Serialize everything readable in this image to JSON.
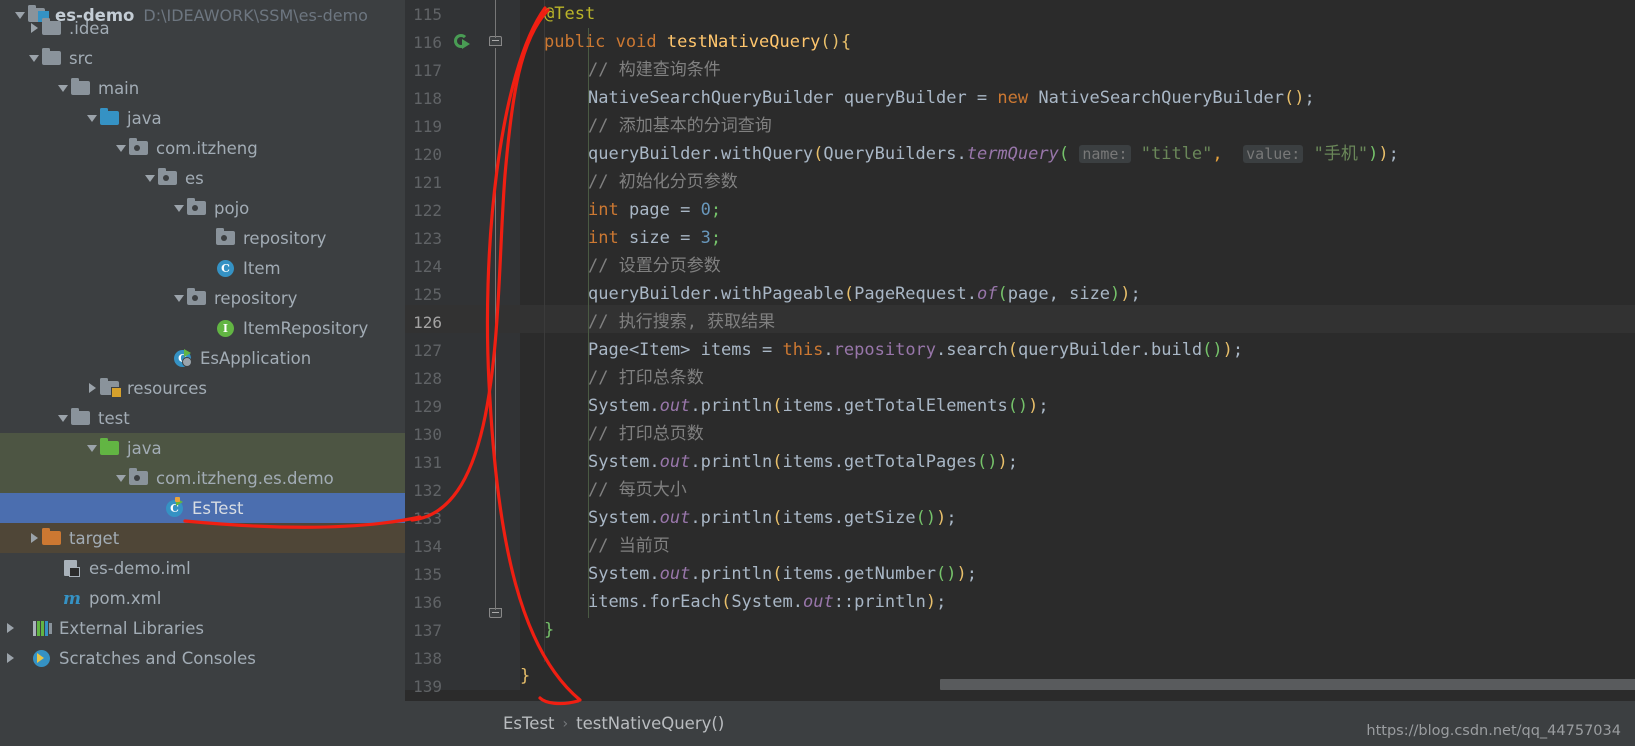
{
  "sidebar": {
    "project_root": {
      "name": "es-demo",
      "path": "D:\\IDEAWORK\\SSM\\es-demo"
    },
    "items": [
      {
        "label": ".idea",
        "indent": 1,
        "arrow": "right",
        "icon": "folder-gray-icon"
      },
      {
        "label": "src",
        "indent": 1,
        "arrow": "down",
        "icon": "folder-gray-icon"
      },
      {
        "label": "main",
        "indent": 2,
        "arrow": "down",
        "icon": "folder-gray-icon"
      },
      {
        "label": "java",
        "indent": 3,
        "arrow": "down",
        "icon": "folder-blue-source-icon"
      },
      {
        "label": "com.itzheng",
        "indent": 4,
        "arrow": "down",
        "icon": "package-icon"
      },
      {
        "label": "es",
        "indent": 5,
        "arrow": "down",
        "icon": "package-icon"
      },
      {
        "label": "pojo",
        "indent": 6,
        "arrow": "down",
        "icon": "package-icon"
      },
      {
        "label": "repository",
        "indent": 7,
        "arrow": "none",
        "icon": "package-icon"
      },
      {
        "label": "Item",
        "indent": 7,
        "arrow": "none",
        "icon": "java-class-icon"
      },
      {
        "label": "repository",
        "indent": 6,
        "arrow": "down",
        "icon": "package-icon"
      },
      {
        "label": "ItemRepository",
        "indent": 7,
        "arrow": "none",
        "icon": "java-interface-icon"
      },
      {
        "label": "EsApplication",
        "indent": 6,
        "arrow": "none",
        "icon": "spring-boot-class-icon"
      },
      {
        "label": "resources",
        "indent": 3,
        "arrow": "right",
        "icon": "folder-resources-icon"
      },
      {
        "label": "test",
        "indent": 2,
        "arrow": "down",
        "icon": "folder-gray-icon"
      },
      {
        "label": "java",
        "indent": 3,
        "arrow": "down",
        "icon": "folder-green-test-source-icon"
      },
      {
        "label": "com.itzheng.es.demo",
        "indent": 4,
        "arrow": "down",
        "icon": "package-icon"
      },
      {
        "label": "EsTest",
        "indent": 5,
        "arrow": "none",
        "icon": "java-test-class-icon"
      },
      {
        "label": "target",
        "indent": 1,
        "arrow": "right",
        "icon": "folder-orange-excluded-icon"
      },
      {
        "label": "es-demo.iml",
        "indent": 2,
        "arrow": "none",
        "icon": "iml-module-file-icon"
      },
      {
        "label": "pom.xml",
        "indent": 2,
        "arrow": "none",
        "icon": "maven-pom-icon"
      },
      {
        "label": "External Libraries",
        "indent": 0,
        "arrow": "right",
        "icon": "libraries-icon"
      },
      {
        "label": "Scratches and Consoles",
        "indent": 0,
        "arrow": "right",
        "icon": "scratches-icon"
      }
    ],
    "selected_item": "EsTest"
  },
  "editor": {
    "first_line_number": 115,
    "current_line_number": 126,
    "line_numbers": [
      115,
      116,
      117,
      118,
      119,
      120,
      121,
      122,
      123,
      124,
      125,
      126,
      127,
      128,
      129,
      130,
      131,
      132,
      133,
      134,
      135,
      136,
      137,
      138,
      139
    ],
    "gutter_run_icon_line": 116,
    "lines": [
      {
        "n": 115,
        "text": "    @Test"
      },
      {
        "n": 116,
        "text": "    public void testNativeQuery(){"
      },
      {
        "n": 117,
        "text": "        // 构建查询条件"
      },
      {
        "n": 118,
        "text": "        NativeSearchQueryBuilder queryBuilder = new NativeSearchQueryBuilder();"
      },
      {
        "n": 119,
        "text": "        // 添加基本的分词查询"
      },
      {
        "n": 120,
        "text": "        queryBuilder.withQuery(QueryBuilders.termQuery( name: \"title\",  value: \"手机\"));"
      },
      {
        "n": 121,
        "text": "        // 初始化分页参数"
      },
      {
        "n": 122,
        "text": "        int page = 0;"
      },
      {
        "n": 123,
        "text": "        int size = 3;"
      },
      {
        "n": 124,
        "text": "        // 设置分页参数"
      },
      {
        "n": 125,
        "text": "        queryBuilder.withPageable(PageRequest.of(page, size));"
      },
      {
        "n": 126,
        "text": "        // 执行搜索, 获取结果"
      },
      {
        "n": 127,
        "text": "        Page<Item> items = this.repository.search(queryBuilder.build());"
      },
      {
        "n": 128,
        "text": "        // 打印总条数"
      },
      {
        "n": 129,
        "text": "        System.out.println(items.getTotalElements());"
      },
      {
        "n": 130,
        "text": "        // 打印总页数"
      },
      {
        "n": 131,
        "text": "        System.out.println(items.getTotalPages());"
      },
      {
        "n": 132,
        "text": "        // 每页大小"
      },
      {
        "n": 133,
        "text": "        System.out.println(items.getSize());"
      },
      {
        "n": 134,
        "text": "        // 当前页"
      },
      {
        "n": 135,
        "text": "        System.out.println(items.getNumber());"
      },
      {
        "n": 136,
        "text": "        items.forEach(System.out::println);"
      },
      {
        "n": 137,
        "text": "    }"
      },
      {
        "n": 138,
        "text": ""
      },
      {
        "n": 139,
        "text": "}"
      }
    ],
    "parameter_hints": [
      {
        "line": 120,
        "label": "name:"
      },
      {
        "line": 120,
        "label": "value:"
      }
    ]
  },
  "breadcrumb": {
    "class": "EsTest",
    "separator": "›",
    "method": "testNativeQuery()"
  },
  "watermark": {
    "text": "https://blog.csdn.net/qq_44757034"
  },
  "colors": {
    "annotation_red": "#f01f12",
    "selection_blue": "#4b6eaf",
    "editor_bg": "#2b2b2b",
    "sidebar_bg": "#3c3f41",
    "gutter_bg": "#313335",
    "keyword_orange": "#cc7832",
    "string_green": "#6a8759",
    "comment_gray": "#808080",
    "number_blue": "#6897bb",
    "method_yellow": "#ffc66d",
    "annotation_yellow": "#bbb529",
    "static_purple": "#9876aa"
  }
}
